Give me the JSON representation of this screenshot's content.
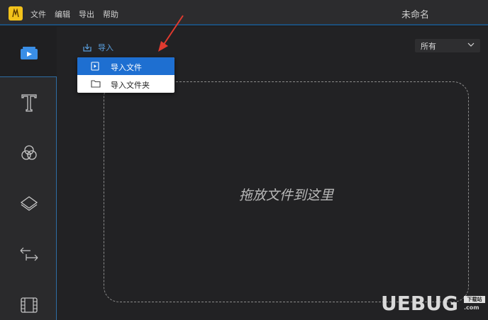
{
  "titlebar": {
    "menu": [
      "文件",
      "编辑",
      "导出",
      "帮助"
    ],
    "doc_title": "未命名"
  },
  "toolbar": {
    "import_label": "导入",
    "filter_value": "所有"
  },
  "dropdown": {
    "items": [
      {
        "label": "导入文件",
        "icon": "file-video-icon"
      },
      {
        "label": "导入文件夹",
        "icon": "folder-icon"
      }
    ]
  },
  "drop_zone": {
    "text": "拖放文件到这里"
  },
  "sidebar": {
    "items": [
      "media-icon",
      "text-icon",
      "filter-icon",
      "overlay-icon",
      "transition-icon",
      "film-icon"
    ]
  },
  "watermark": {
    "brand": "UEBUG",
    "badge": "下载站",
    "sub": ".com"
  },
  "colors": {
    "accent": "#1e6fd1",
    "logo": "#f2c21b",
    "arrow": "#e03a2f"
  }
}
